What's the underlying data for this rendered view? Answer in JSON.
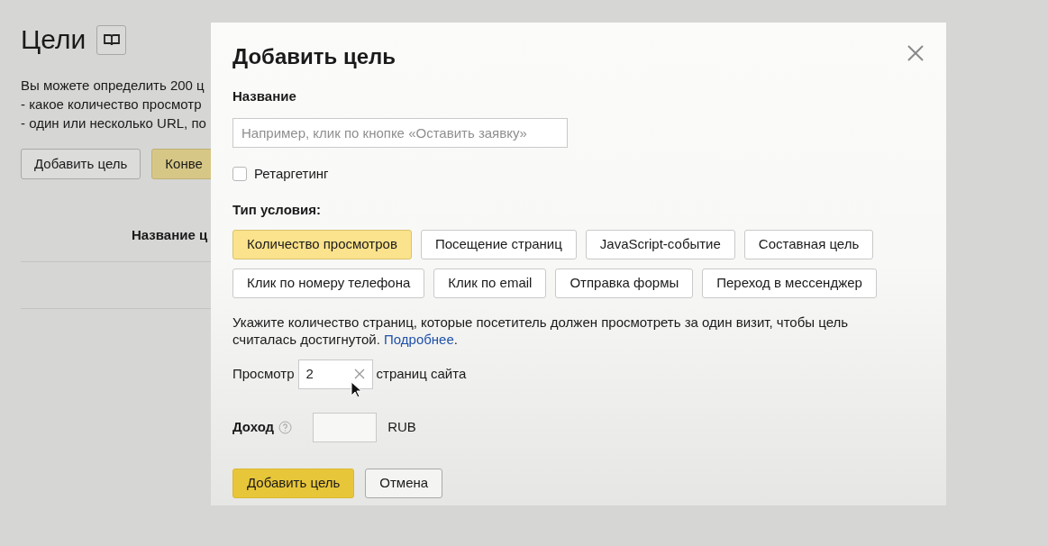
{
  "page": {
    "title": "Цели",
    "intro_lines": [
      "Вы можете определить 200 ц",
      "-  какое количество просмотр",
      "-  один или несколько URL, по"
    ],
    "buttons": [
      {
        "label": "Добавить цель",
        "kind": "default"
      },
      {
        "label": "Конве",
        "kind": "accent"
      }
    ],
    "table_header": "Название ц"
  },
  "dialog": {
    "title": "Добавить цель",
    "name_label": "Название",
    "name_field": {
      "placeholder": "Например, клик по кнопке «Оставить заявку»"
    },
    "retargeting": {
      "label": "Ретаргетинг",
      "checked": false
    },
    "condition_label": "Тип условия:",
    "condition_types": [
      {
        "label": "Количество просмотров",
        "selected": true
      },
      {
        "label": "Посещение страниц",
        "selected": false
      },
      {
        "label": "JavaScript-событие",
        "selected": false
      },
      {
        "label": "Составная цель",
        "selected": false
      },
      {
        "label": "Клик по номеру телефона",
        "selected": false
      },
      {
        "label": "Клик по email",
        "selected": false
      },
      {
        "label": "Отправка формы",
        "selected": false
      },
      {
        "label": "Переход в мессенджер",
        "selected": false
      }
    ],
    "description": {
      "text": "Укажите количество страниц, которые посетитель должен просмотреть за один визит, чтобы цель считалась достигнутой.",
      "link": "Подробнее",
      "after": "."
    },
    "views": {
      "prefix": "Просмотр",
      "value": "2",
      "suffix": "страниц сайта"
    },
    "income": {
      "label": "Доход",
      "currency": "RUB"
    },
    "actions": [
      {
        "label": "Добавить цель",
        "kind": "primary"
      },
      {
        "label": "Отмена",
        "kind": "default"
      }
    ]
  }
}
